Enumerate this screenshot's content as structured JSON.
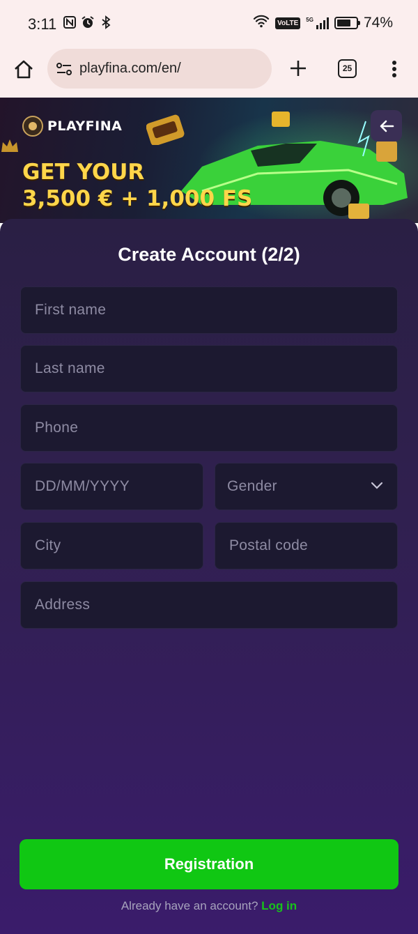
{
  "status_bar": {
    "time": "3:11",
    "left_icons": [
      "nfc-icon",
      "alarm-icon",
      "bluetooth-icon"
    ],
    "volte_label": "VoLTE",
    "network_label": "5G",
    "battery_percent": "74%",
    "battery_level": 0.74
  },
  "browser": {
    "url": "playfina.com/en/",
    "tab_count": "25"
  },
  "hero": {
    "logo_text": "PLAYFINA",
    "promo_line1": "GET YOUR",
    "promo_line2": "3,500 € + 1,000 FS"
  },
  "form": {
    "title": "Create Account (2/2)",
    "first_name_placeholder": "First name",
    "last_name_placeholder": "Last name",
    "phone_placeholder": "Phone",
    "dob_placeholder": "DD/MM/YYYY",
    "gender_label": "Gender",
    "city_placeholder": "City",
    "postal_placeholder": "Postal code",
    "address_placeholder": "Address",
    "submit_label": "Registration",
    "login_prompt": "Already have an account?",
    "login_link": "Log in"
  },
  "colors": {
    "status_bg": "#fbeeee",
    "panel_top": "#2a1f44",
    "panel_bottom": "#3a1c6b",
    "field_bg": "#1c1930",
    "accent_green": "#10c713",
    "promo_yellow": "#ffd64a"
  }
}
